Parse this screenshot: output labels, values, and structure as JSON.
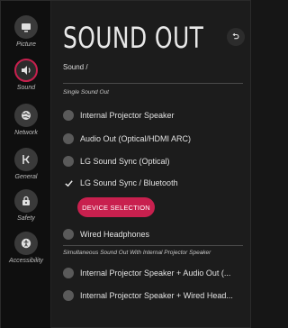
{
  "sidebar": {
    "items": [
      {
        "label": "Picture",
        "icon": "picture-icon"
      },
      {
        "label": "Sound",
        "icon": "speaker-icon"
      },
      {
        "label": "Network",
        "icon": "globe-icon"
      },
      {
        "label": "General",
        "icon": "general-icon"
      },
      {
        "label": "Safety",
        "icon": "lock-icon"
      },
      {
        "label": "Accessibility",
        "icon": "accessibility-icon"
      }
    ],
    "active_label": "Sound",
    "accent_color": "#c8204e"
  },
  "header": {
    "title": "SOUND OUT",
    "breadcrumb": "Sound /",
    "back_icon": "back-arrow-icon"
  },
  "sections": {
    "single_label": "Single Sound Out",
    "simultaneous_label": "Simultaneous Sound Out With Internal Projector Speaker"
  },
  "options": {
    "internal_projector_speaker": "Internal Projector Speaker",
    "audio_out": "Audio Out (Optical/HDMI ARC)",
    "lg_sound_sync_optical": "LG Sound Sync (Optical)",
    "lg_sound_sync_bluetooth": "LG Sound Sync / Bluetooth",
    "wired_headphones": "Wired Headphones",
    "internal_plus_audio_out": "Internal Projector Speaker + Audio Out (...",
    "internal_plus_wired": "Internal Projector Speaker + Wired Head..."
  },
  "selected_option": "LG Sound Sync / Bluetooth",
  "device_selection_label": "DEVICE SELECTION"
}
